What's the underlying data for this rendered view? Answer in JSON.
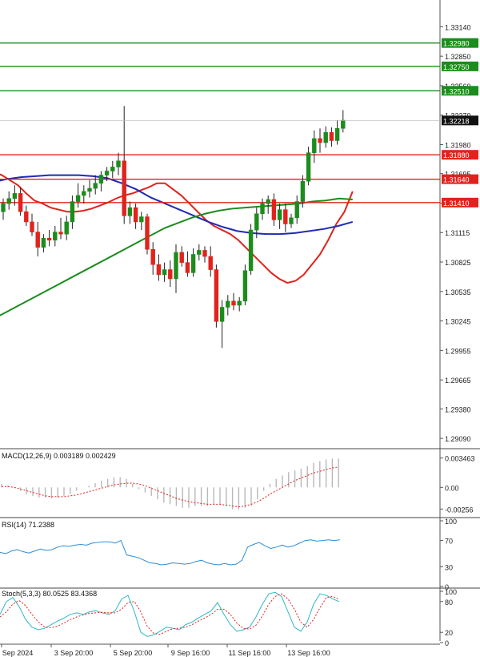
{
  "chart_data": {
    "type": "candlestick",
    "instrument_note": "",
    "price_axis_labels": [
      "1.33140",
      "1.32850",
      "1.32560",
      "1.32270",
      "1.31980",
      "1.31695",
      "1.31405",
      "1.31115",
      "1.30825",
      "1.30535",
      "1.30245",
      "1.29955",
      "1.29665",
      "1.29380",
      "1.29090"
    ],
    "price_axis_values": [
      1.3314,
      1.3285,
      1.3256,
      1.3227,
      1.3198,
      1.31695,
      1.31405,
      1.31115,
      1.30825,
      1.30535,
      1.30245,
      1.29955,
      1.29665,
      1.2938,
      1.2909
    ],
    "ylim": [
      1.2902,
      1.3334
    ],
    "current_price": {
      "label": "1.32218",
      "value": 1.32218
    },
    "levels": [
      {
        "label": "1.32980",
        "value": 1.3298,
        "kind": "resistance",
        "color": "#1c8c1c"
      },
      {
        "label": "1.32750",
        "value": 1.3275,
        "kind": "resistance",
        "color": "#1c8c1c"
      },
      {
        "label": "1.32510",
        "value": 1.3251,
        "kind": "resistance",
        "color": "#1c8c1c"
      },
      {
        "label": "1.31880",
        "value": 1.3188,
        "kind": "support",
        "color": "#e0231c"
      },
      {
        "label": "1.31640",
        "value": 1.3164,
        "kind": "support",
        "color": "#e0231c"
      },
      {
        "label": "1.31410",
        "value": 1.3141,
        "kind": "support",
        "color": "#e0231c"
      }
    ],
    "x_labels": [
      "Sep 2024",
      "3 Sep 20:00",
      "5 Sep 20:00",
      "9 Sep 16:00",
      "11 Sep 16:00",
      "13 Sep 16:00"
    ],
    "x_label_candle_index": [
      0,
      13,
      26,
      39,
      52,
      65
    ],
    "candles": [
      [
        1.3132,
        1.3145,
        1.3124,
        1.314
      ],
      [
        1.314,
        1.3152,
        1.3134,
        1.3145
      ],
      [
        1.3145,
        1.3158,
        1.3138,
        1.315
      ],
      [
        1.315,
        1.3156,
        1.3128,
        1.3132
      ],
      [
        1.3132,
        1.3138,
        1.3118,
        1.3122
      ],
      [
        1.3122,
        1.313,
        1.3108,
        1.3112
      ],
      [
        1.3112,
        1.3122,
        1.3088,
        1.3097
      ],
      [
        1.3097,
        1.311,
        1.3092,
        1.3106
      ],
      [
        1.3106,
        1.3114,
        1.3098,
        1.3104
      ],
      [
        1.3104,
        1.3118,
        1.3098,
        1.3112
      ],
      [
        1.3112,
        1.3126,
        1.3105,
        1.311
      ],
      [
        1.311,
        1.3128,
        1.3104,
        1.3122
      ],
      [
        1.3122,
        1.3148,
        1.3115,
        1.3142
      ],
      [
        1.3142,
        1.316,
        1.3136,
        1.3148
      ],
      [
        1.3148,
        1.3158,
        1.314,
        1.3152
      ],
      [
        1.3152,
        1.3163,
        1.3146,
        1.3155
      ],
      [
        1.3155,
        1.3168,
        1.3149,
        1.316
      ],
      [
        1.316,
        1.3172,
        1.3152,
        1.3168
      ],
      [
        1.3168,
        1.3176,
        1.3162,
        1.3172
      ],
      [
        1.3172,
        1.3182,
        1.3165,
        1.3176
      ],
      [
        1.3176,
        1.319,
        1.3168,
        1.3182
      ],
      [
        1.3182,
        1.3236,
        1.312,
        1.3128
      ],
      [
        1.3128,
        1.3142,
        1.312,
        1.3136
      ],
      [
        1.3136,
        1.314,
        1.3115,
        1.3122
      ],
      [
        1.3122,
        1.3132,
        1.3114,
        1.3127
      ],
      [
        1.3127,
        1.313,
        1.309,
        1.3095
      ],
      [
        1.3095,
        1.3102,
        1.307,
        1.308
      ],
      [
        1.308,
        1.309,
        1.3064,
        1.307
      ],
      [
        1.307,
        1.3082,
        1.3063,
        1.3075
      ],
      [
        1.3075,
        1.3084,
        1.3058,
        1.3066
      ],
      [
        1.3066,
        1.31,
        1.3052,
        1.3092
      ],
      [
        1.3092,
        1.3098,
        1.3078,
        1.3082
      ],
      [
        1.3082,
        1.3093,
        1.3068,
        1.3072
      ],
      [
        1.3072,
        1.3096,
        1.3068,
        1.309
      ],
      [
        1.309,
        1.31,
        1.3084,
        1.3094
      ],
      [
        1.3094,
        1.3098,
        1.3082,
        1.3088
      ],
      [
        1.3088,
        1.3098,
        1.3068,
        1.3075
      ],
      [
        1.3075,
        1.308,
        1.3018,
        1.3024
      ],
      [
        1.3024,
        1.3045,
        1.2998,
        1.3038
      ],
      [
        1.3038,
        1.305,
        1.303,
        1.3044
      ],
      [
        1.3044,
        1.3052,
        1.3035,
        1.304
      ],
      [
        1.304,
        1.3048,
        1.3034,
        1.3044
      ],
      [
        1.3044,
        1.308,
        1.304,
        1.3074
      ],
      [
        1.3074,
        1.312,
        1.307,
        1.3114
      ],
      [
        1.3114,
        1.3136,
        1.3106,
        1.313
      ],
      [
        1.313,
        1.3145,
        1.3124,
        1.314
      ],
      [
        1.314,
        1.3148,
        1.313,
        1.3144
      ],
      [
        1.3144,
        1.315,
        1.3118,
        1.3124
      ],
      [
        1.3124,
        1.314,
        1.3115,
        1.3134
      ],
      [
        1.3134,
        1.314,
        1.3112,
        1.312
      ],
      [
        1.312,
        1.313,
        1.3116,
        1.3126
      ],
      [
        1.3126,
        1.3148,
        1.312,
        1.3142
      ],
      [
        1.3142,
        1.3168,
        1.3136,
        1.3162
      ],
      [
        1.3162,
        1.3196,
        1.3158,
        1.319
      ],
      [
        1.319,
        1.3212,
        1.318,
        1.3204
      ],
      [
        1.3204,
        1.3214,
        1.319,
        1.32
      ],
      [
        1.32,
        1.3216,
        1.3195,
        1.321
      ],
      [
        1.321,
        1.3215,
        1.3196,
        1.3202
      ],
      [
        1.3202,
        1.3222,
        1.3198,
        1.3214
      ],
      [
        1.3214,
        1.3232,
        1.321,
        1.3222
      ]
    ],
    "ma_lines": [
      {
        "name": "",
        "color": "#e0231c",
        "values": [
          1.3171,
          1.3168,
          1.3163,
          1.3158,
          1.315,
          1.3143,
          1.314,
          1.3136,
          1.3134,
          1.3132,
          1.3132,
          1.3133,
          1.3135,
          1.3138,
          1.3141,
          1.3145,
          1.3148,
          1.315,
          1.3153,
          1.3156,
          1.316,
          1.316,
          1.3154,
          1.3148,
          1.314,
          1.3132,
          1.3124,
          1.3118,
          1.3114,
          1.311,
          1.3104,
          1.3096,
          1.3088,
          1.308,
          1.3072,
          1.3066,
          1.3062,
          1.3064,
          1.307,
          1.308,
          1.309,
          1.3104,
          1.312,
          1.3132,
          1.3152
        ]
      },
      {
        "name": "",
        "color": "#1f2bb5",
        "values": [
          1.3161,
          1.3164,
          1.3166,
          1.3167,
          1.3168,
          1.3168,
          1.3168,
          1.3167,
          1.3165,
          1.316,
          1.3154,
          1.3146,
          1.314,
          1.3134,
          1.3128,
          1.3122,
          1.3117,
          1.3113,
          1.3111,
          1.311,
          1.311,
          1.3111,
          1.3113,
          1.3115,
          1.3118,
          1.3122
        ]
      },
      {
        "name": "",
        "color": "#1c8c1c",
        "values": [
          1.3025,
          1.3032,
          1.3039,
          1.3046,
          1.3053,
          1.306,
          1.3067,
          1.3074,
          1.3081,
          1.3088,
          1.3095,
          1.3102,
          1.3109,
          1.3116,
          1.3121,
          1.3126,
          1.313,
          1.3133,
          1.3135,
          1.3136,
          1.3137,
          1.3138,
          1.3139,
          1.314,
          1.3142,
          1.3143,
          1.3145,
          1.3144
        ]
      }
    ],
    "macd": {
      "label": "MACD(12,26,9) 0.003189 0.002429",
      "axis_labels": [
        "0.003463",
        "0.00",
        "-0.00256"
      ],
      "axis_values": [
        0.003463,
        0.0,
        -0.00256
      ],
      "ylim": [
        -0.003,
        0.004
      ],
      "histogram": [
        0.0004,
        0.0002,
        0.0,
        -0.0004,
        -0.0008,
        -0.001,
        -0.0012,
        -0.0012,
        -0.0013,
        -0.0012,
        -0.001,
        -0.0008,
        -0.0004,
        0.0,
        0.0002,
        0.0005,
        0.0008,
        0.001,
        0.0012,
        0.0012,
        0.001,
        0.0004,
        -0.0002,
        -0.0006,
        -0.001,
        -0.0014,
        -0.0018,
        -0.002,
        -0.0022,
        -0.0024,
        -0.0024,
        -0.0022,
        -0.0022,
        -0.0022,
        -0.002,
        -0.002,
        -0.0022,
        -0.0026,
        -0.0026,
        -0.0024,
        -0.0022,
        -0.0014,
        -0.0004,
        0.0004,
        0.001,
        0.0014,
        0.0018,
        0.002,
        0.0022,
        0.0025,
        0.0029,
        0.0031,
        0.0033,
        0.0034,
        0.0034
      ],
      "signal": [
        0.0001,
        0.0001,
        0.0,
        -0.0002,
        -0.0004,
        -0.0006,
        -0.0008,
        -0.001,
        -0.0011,
        -0.0011,
        -0.0011,
        -0.001,
        -0.0009,
        -0.0007,
        -0.0005,
        -0.0003,
        -0.0001,
        0.0001,
        0.0003,
        0.0004,
        0.0005,
        0.0005,
        0.0004,
        0.0002,
        -0.0001,
        -0.0004,
        -0.0007,
        -0.001,
        -0.0013,
        -0.0015,
        -0.0017,
        -0.0018,
        -0.0019,
        -0.002,
        -0.002,
        -0.002,
        -0.0021,
        -0.0022,
        -0.0023,
        -0.0022,
        -0.002,
        -0.0017,
        -0.0013,
        -0.0008,
        -0.0004,
        0.0,
        0.0004,
        0.0008,
        0.0011,
        0.0014,
        0.0017,
        0.0019,
        0.0021,
        0.0023,
        0.0024
      ]
    },
    "rsi": {
      "label": "RSI(14) 71.2388",
      "axis_labels": [
        "100",
        "70",
        "30",
        "0"
      ],
      "axis_values": [
        100,
        70,
        30,
        0
      ],
      "values": [
        52,
        50,
        54,
        56,
        53,
        51,
        54,
        57,
        55,
        56,
        60,
        62,
        61,
        63,
        64,
        63,
        66,
        67,
        68,
        68,
        66,
        70,
        48,
        46,
        44,
        40,
        36,
        35,
        33,
        34,
        36,
        35,
        34,
        35,
        38,
        40,
        36,
        34,
        33,
        35,
        33,
        34,
        40,
        60,
        64,
        67,
        62,
        58,
        60,
        63,
        60,
        62,
        66,
        70,
        71,
        69,
        70,
        71,
        70,
        71
      ]
    },
    "stoch": {
      "label": "Stoch(5,3,3) 80.0525 83.4368",
      "axis_labels": [
        "100",
        "80",
        "20",
        "0"
      ],
      "axis_values": [
        100,
        80,
        20,
        0
      ],
      "k": [
        55,
        80,
        88,
        70,
        45,
        30,
        25,
        28,
        35,
        42,
        48,
        55,
        58,
        55,
        60,
        62,
        58,
        55,
        62,
        85,
        92,
        60,
        20,
        12,
        15,
        22,
        30,
        28,
        25,
        35,
        40,
        48,
        55,
        62,
        78,
        55,
        35,
        22,
        25,
        30,
        50,
        75,
        95,
        98,
        90,
        60,
        30,
        22,
        40,
        75,
        95,
        92,
        85,
        80
      ],
      "d": [
        50,
        60,
        75,
        82,
        72,
        55,
        40,
        30,
        29,
        32,
        38,
        45,
        50,
        54,
        57,
        58,
        59,
        58,
        58,
        65,
        78,
        80,
        60,
        32,
        18,
        16,
        22,
        27,
        28,
        30,
        35,
        42,
        48,
        55,
        65,
        65,
        55,
        38,
        28,
        26,
        34,
        52,
        75,
        90,
        95,
        85,
        65,
        40,
        30,
        45,
        68,
        88,
        90,
        84
      ]
    }
  }
}
